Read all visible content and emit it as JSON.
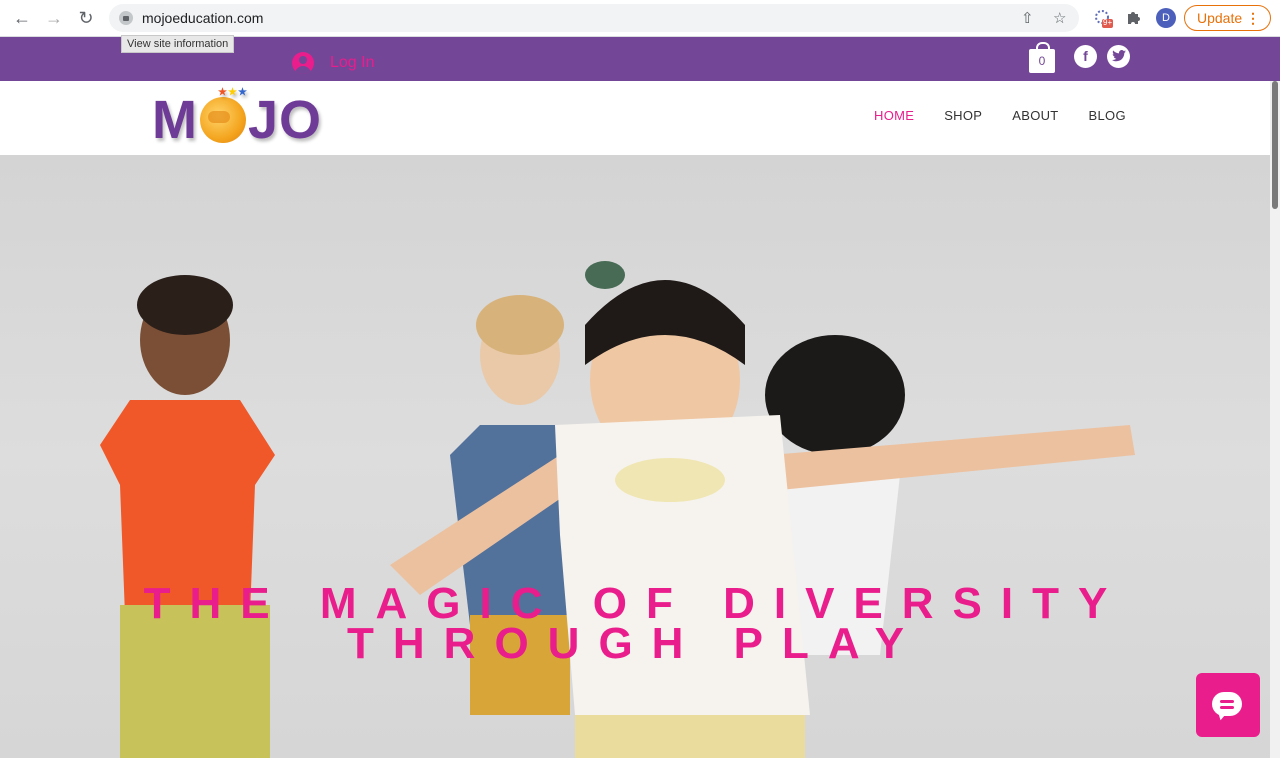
{
  "browser": {
    "url": "mojoeducation.com",
    "tooltip": "View site information",
    "update_label": "Update",
    "profile_initial": "D",
    "extension_badge": "9+"
  },
  "topbar": {
    "login_label": "Log In",
    "cart_count": "0",
    "social": [
      "facebook",
      "twitter"
    ]
  },
  "header": {
    "logo_text_left": "M",
    "logo_text_right": "JO",
    "menu": [
      {
        "label": "HOME",
        "active": true
      },
      {
        "label": "SHOP",
        "active": false
      },
      {
        "label": "ABOUT",
        "active": false
      },
      {
        "label": "BLOG",
        "active": false
      }
    ]
  },
  "hero": {
    "title_line1": "THE MAGIC OF DIVERSITY",
    "title_line2": "THROUGH PLAY"
  },
  "colors": {
    "brand_purple": "#734697",
    "accent_pink": "#ea1d8c"
  },
  "icons": [
    "back-icon",
    "forward-icon",
    "reload-icon",
    "lock-icon",
    "share-icon",
    "star-icon",
    "extension-icon",
    "puzzle-icon",
    "cart-icon",
    "facebook-icon",
    "twitter-icon",
    "chat-icon",
    "user-icon"
  ]
}
